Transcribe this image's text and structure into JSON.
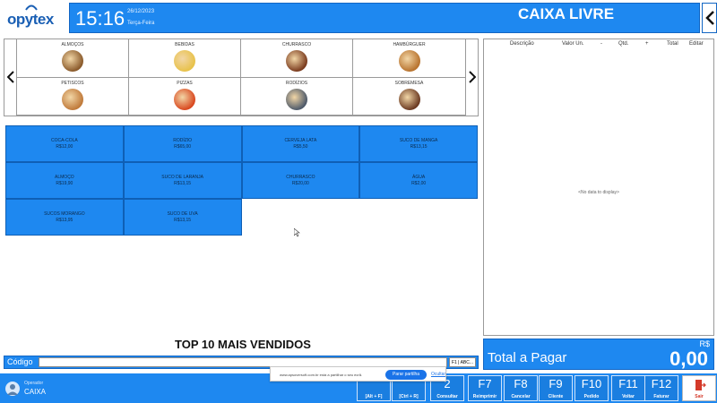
{
  "app": {
    "logo": "opytex"
  },
  "header": {
    "time": "15:16",
    "date": "26/12/2023",
    "weekday": "Terça-Feira",
    "status": "CAIXA LIVRE"
  },
  "categories": [
    {
      "label": "ALMOÇOS",
      "color": "#8a5a2b"
    },
    {
      "label": "BEBIDAS",
      "color": "#e8c24a"
    },
    {
      "label": "CHURRASCO",
      "color": "#7a3b1e"
    },
    {
      "label": "HAMBÚRGUER",
      "color": "#b8732e"
    },
    {
      "label": "PETISCOS",
      "color": "#c07a3a"
    },
    {
      "label": "PIZZAS",
      "color": "#d9481f"
    },
    {
      "label": "RODÍZIOS",
      "color": "#4e5a6a"
    },
    {
      "label": "SOBREMESA",
      "color": "#6b3a22"
    }
  ],
  "products": [
    {
      "name": "COCA-COLA",
      "price": "R$12,00"
    },
    {
      "name": "RODÍZIO",
      "price": "R$65,00"
    },
    {
      "name": "CERVEJA LATA",
      "price": "R$5,50"
    },
    {
      "name": "SUCO DE MANGA",
      "price": "R$13,15"
    },
    {
      "name": "ALMOÇO",
      "price": "R$19,90"
    },
    {
      "name": "SUCO DE LARANJA",
      "price": "R$13,15"
    },
    {
      "name": "CHURRASCO",
      "price": "R$20,00"
    },
    {
      "name": "ÁGUA",
      "price": "R$2,00"
    },
    {
      "name": "SUCOS MORANGO",
      "price": "R$13,95"
    },
    {
      "name": "SUCO DE UVA",
      "price": "R$13,15"
    }
  ],
  "top10_label": "TOP 10 MAIS VENDIDOS",
  "codigo": {
    "label": "Código",
    "value": "",
    "search_hint": "F1 | ABC..."
  },
  "cart_table": {
    "columns": [
      "Descrição",
      "Valor Un.",
      "-",
      "Qtd.",
      "+",
      "Total",
      "Editar"
    ],
    "empty_text": "<No data to display>"
  },
  "total": {
    "currency": "R$",
    "label": "Total a Pagar",
    "value": "0,00"
  },
  "operator": {
    "role": "Operador",
    "name": "CAIXA"
  },
  "share_bar": {
    "text": "www.apsoversoft.com.br está a partilhar o seu ecrã.",
    "button": "Parar partilha",
    "hide": "Ocultar"
  },
  "function_keys": [
    {
      "key": "",
      "label": "[Alt + F]"
    },
    {
      "key": "",
      "label": "[Ctrl + R]"
    },
    {
      "key": "2",
      "label": "Consultar"
    },
    {
      "key": "F7",
      "label": "Reimprimir"
    },
    {
      "key": "F8",
      "label": "Cancelar"
    },
    {
      "key": "F9",
      "label": "Cliente"
    },
    {
      "key": "F10",
      "label": "Pedido"
    },
    {
      "key": "F11",
      "label": "Voltar"
    },
    {
      "key": "F12",
      "label": "Faturar"
    },
    {
      "key": "",
      "label": "Sair"
    }
  ],
  "colors": {
    "accent": "#1e88f0",
    "accent_dark": "#1266c4",
    "exit": "#d43a2a"
  }
}
